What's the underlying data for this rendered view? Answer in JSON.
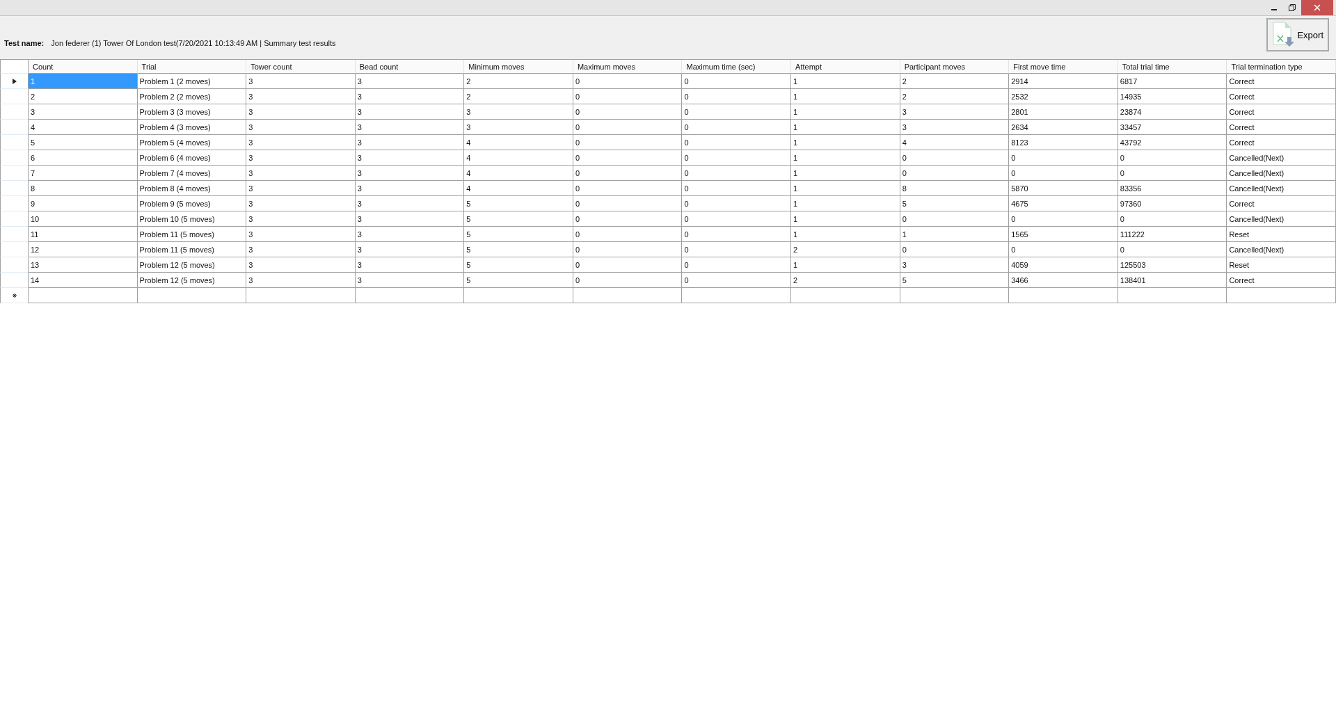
{
  "header": {
    "label": "Test name:",
    "value": "Jon federer  (1) Tower Of London test(7/20/2021 10:13:49 AM | Summary test results"
  },
  "export_button": {
    "label": "Export"
  },
  "table": {
    "columns": [
      "Count",
      "Trial",
      "Tower count",
      "Bead count",
      "Minimum moves",
      "Maximum moves",
      "Maximum time (sec)",
      "Attempt",
      "Participant moves",
      "First move time",
      "Total trial time",
      "Trial termination type"
    ],
    "rows": [
      {
        "selected": true,
        "cells": [
          "1",
          "Problem 1 (2 moves)",
          "3",
          "3",
          "2",
          "0",
          "0",
          "1",
          "2",
          "2914",
          "6817",
          "Correct"
        ]
      },
      {
        "selected": false,
        "cells": [
          "2",
          "Problem 2 (2 moves)",
          "3",
          "3",
          "2",
          "0",
          "0",
          "1",
          "2",
          "2532",
          "14935",
          "Correct"
        ]
      },
      {
        "selected": false,
        "cells": [
          "3",
          "Problem 3 (3 moves)",
          "3",
          "3",
          "3",
          "0",
          "0",
          "1",
          "3",
          "2801",
          "23874",
          "Correct"
        ]
      },
      {
        "selected": false,
        "cells": [
          "4",
          "Problem 4 (3 moves)",
          "3",
          "3",
          "3",
          "0",
          "0",
          "1",
          "3",
          "2634",
          "33457",
          "Correct"
        ]
      },
      {
        "selected": false,
        "cells": [
          "5",
          "Problem 5 (4 moves)",
          "3",
          "3",
          "4",
          "0",
          "0",
          "1",
          "4",
          "8123",
          "43792",
          "Correct"
        ]
      },
      {
        "selected": false,
        "cells": [
          "6",
          "Problem 6 (4 moves)",
          "3",
          "3",
          "4",
          "0",
          "0",
          "1",
          "0",
          "0",
          "0",
          "Cancelled(Next)"
        ]
      },
      {
        "selected": false,
        "cells": [
          "7",
          "Problem 7 (4 moves)",
          "3",
          "3",
          "4",
          "0",
          "0",
          "1",
          "0",
          "0",
          "0",
          "Cancelled(Next)"
        ]
      },
      {
        "selected": false,
        "cells": [
          "8",
          "Problem 8 (4 moves)",
          "3",
          "3",
          "4",
          "0",
          "0",
          "1",
          "8",
          "5870",
          "83356",
          "Cancelled(Next)"
        ]
      },
      {
        "selected": false,
        "cells": [
          "9",
          "Problem 9 (5 moves)",
          "3",
          "3",
          "5",
          "0",
          "0",
          "1",
          "5",
          "4675",
          "97360",
          "Correct"
        ]
      },
      {
        "selected": false,
        "cells": [
          "10",
          "Problem 10 (5 moves)",
          "3",
          "3",
          "5",
          "0",
          "0",
          "1",
          "0",
          "0",
          "0",
          "Cancelled(Next)"
        ]
      },
      {
        "selected": false,
        "cells": [
          "11",
          "Problem 11 (5 moves)",
          "3",
          "3",
          "5",
          "0",
          "0",
          "1",
          "1",
          "1565",
          "111222",
          "Reset"
        ]
      },
      {
        "selected": false,
        "cells": [
          "12",
          "Problem 11 (5 moves)",
          "3",
          "3",
          "5",
          "0",
          "0",
          "2",
          "0",
          "0",
          "0",
          "Cancelled(Next)"
        ]
      },
      {
        "selected": false,
        "cells": [
          "13",
          "Problem 12 (5 moves)",
          "3",
          "3",
          "5",
          "0",
          "0",
          "1",
          "3",
          "4059",
          "125503",
          "Reset"
        ]
      },
      {
        "selected": false,
        "cells": [
          "14",
          "Problem 12 (5 moves)",
          "3",
          "3",
          "5",
          "0",
          "0",
          "2",
          "5",
          "3466",
          "138401",
          "Correct"
        ]
      }
    ]
  }
}
